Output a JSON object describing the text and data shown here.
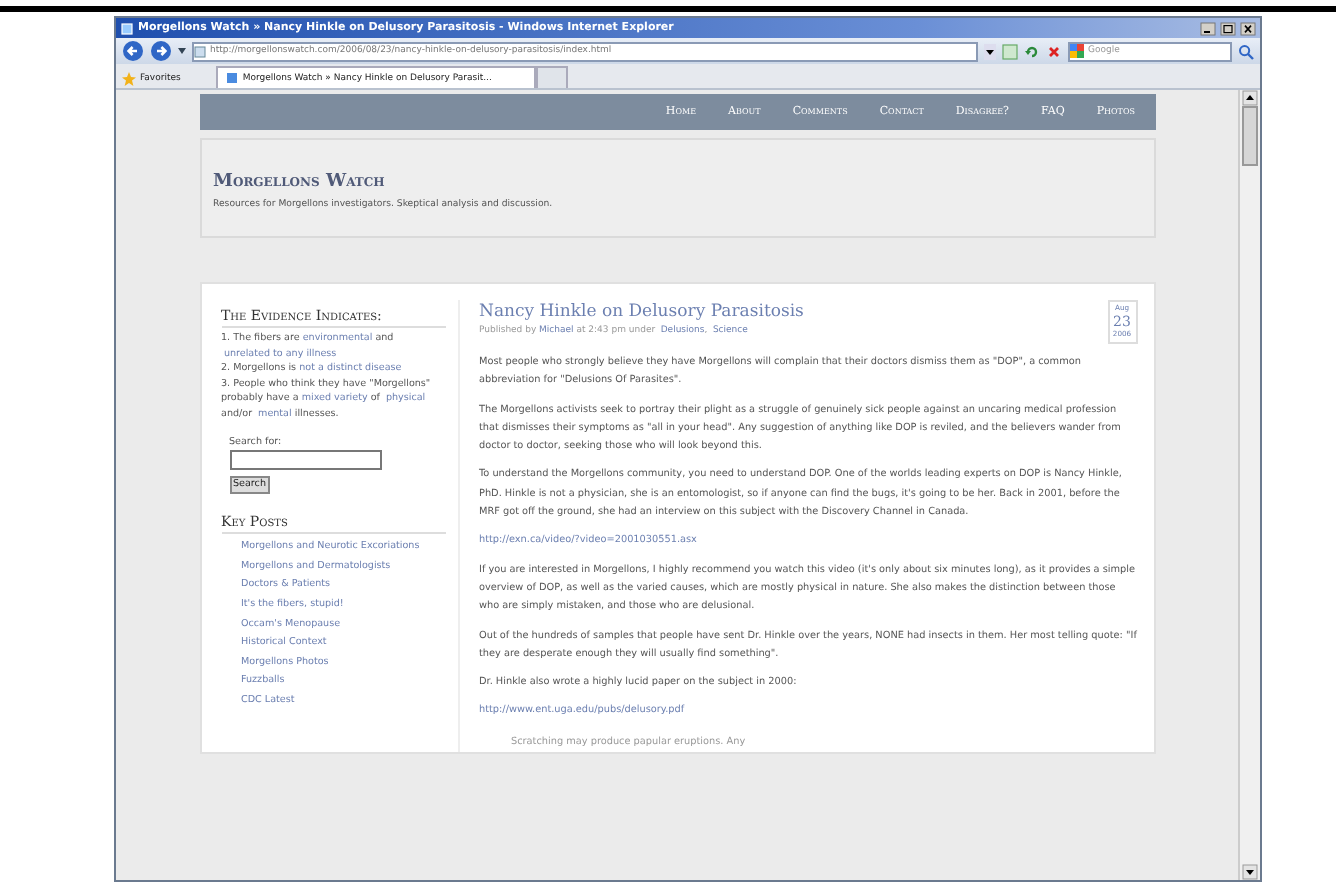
{
  "window": {
    "title": "Morgellons Watch » Nancy Hinkle on Delusory Parasitosis - Windows Internet Explorer"
  },
  "address_bar": {
    "value": "http://morgellonswatch.com/2006/08/23/nancy-hinkle-on-delusory-parasitosis/index.html"
  },
  "search_box": {
    "placeholder": "Google"
  },
  "favorites": {
    "label": "Favorites"
  },
  "tabs": [
    {
      "label": "Morgellons Watch » Nancy Hinkle on Delusory Parasit...",
      "selected": true
    }
  ],
  "site": {
    "nav": [
      {
        "label": "Home"
      },
      {
        "label": "About"
      },
      {
        "label": "Comments"
      },
      {
        "label": "Contact"
      },
      {
        "label": "Disagree?"
      },
      {
        "label": "FAQ"
      },
      {
        "label": "Photos"
      }
    ],
    "title": "Morgellons Watch",
    "tagline": "Resources for Morgellons investigators. Skeptical analysis and discussion."
  },
  "sidebar": {
    "heading": "The Evidence Indicates:",
    "points": [
      [
        {
          "text": "1. The fibers are ",
          "kind": "text"
        },
        {
          "text": "environmental",
          "kind": "link"
        },
        {
          "text": " and ",
          "kind": "text"
        },
        {
          "text": "unrelated to any illness",
          "kind": "link"
        }
      ],
      [
        {
          "text": "2. Morgellons is ",
          "kind": "text"
        },
        {
          "text": "not a distinct",
          "kind": "link"
        },
        {
          "text": "disease",
          "kind": "link"
        }
      ],
      [
        {
          "text": "3. People who think they have \"Morgellons\" probably have a ",
          "kind": "text"
        },
        {
          "text": "mixed variety",
          "kind": "link"
        },
        {
          "text": " of ",
          "kind": "text"
        },
        {
          "text": "physical",
          "kind": "link"
        },
        {
          "text": " and/or ",
          "kind": "text"
        },
        {
          "text": "mental",
          "kind": "link"
        },
        {
          "text": " illnesses.",
          "kind": "text"
        }
      ]
    ],
    "search": {
      "label": "Search for:",
      "button": "Search"
    },
    "key_posts_heading": "Key Posts",
    "key_posts": [
      "Morgellons and Neurotic Excoriations",
      "Morgellons and Dermatologists",
      "Doctors & Patients",
      "It's the fibers, stupid!",
      "Occam's Menopause",
      "Historical Context",
      "Morgellons Photos",
      "Fuzzballs",
      "CDC Latest"
    ]
  },
  "post": {
    "title": "Nancy Hinkle on Delusory Parasitosis",
    "date": {
      "month": "Aug",
      "day": "23",
      "year": "2006"
    },
    "meta": [
      {
        "text": "Published by ",
        "kind": "text"
      },
      {
        "text": "Michael",
        "kind": "link"
      },
      {
        "text": " at 2:43 pm under ",
        "kind": "text"
      },
      {
        "text": "Delusions",
        "kind": "link"
      },
      {
        "text": ", ",
        "kind": "text"
      },
      {
        "text": "Science",
        "kind": "link"
      }
    ],
    "blocks": [
      {
        "kind": "paragraph",
        "text": "Most people who strongly believe they have Morgellons will complain that their doctors dismiss them as \"DOP\", a common abbreviation for \"Delusions Of Parasites\"."
      },
      {
        "kind": "paragraph",
        "text": "The Morgellons activists seek to portray their plight as a struggle of genuinely sick people against an uncaring medical profession that dismisses their symptoms as \"all in your head\". Any suggestion of anything like DOP is reviled, and the believers wander from doctor to doctor, seeking those who will look beyond this."
      },
      {
        "kind": "paragraph",
        "text": "To understand the Morgellons community, you need to understand DOP. One of the worlds leading experts on DOP is Nancy Hinkle, PhD. Hinkle is not a physician, she is an entomologist, so if anyone can find the bugs, it's going to be her. Back in 2001, before the MRF got off the ground, she had an interview on this subject with the Discovery Channel in Canada."
      },
      {
        "kind": "link",
        "text": "http://exn.ca/video/?video=2001030551.asx"
      },
      {
        "kind": "paragraph",
        "text": "If you are interested in Morgellons, I highly recommend you watch this video (it's only about six minutes long), as it provides a simple overview of DOP, as well as the varied causes, which are mostly physical in nature. She also makes the distinction between those who are simply mistaken, and those who are delusional."
      },
      {
        "kind": "paragraph",
        "text": "Out of the hundreds of samples that people have sent Dr. Hinkle over the years, NONE had insects in them. Her most telling quote: \"If they are desperate enough they will usually find something\"."
      },
      {
        "kind": "paragraph",
        "text": "Dr. Hinkle also wrote a highly lucid paper on the subject in 2000:"
      },
      {
        "kind": "link",
        "text": "http://www.ent.uga.edu/pubs/delusory.pdf"
      },
      {
        "kind": "quote",
        "text": "Scratching may produce papular eruptions. Any"
      }
    ]
  }
}
